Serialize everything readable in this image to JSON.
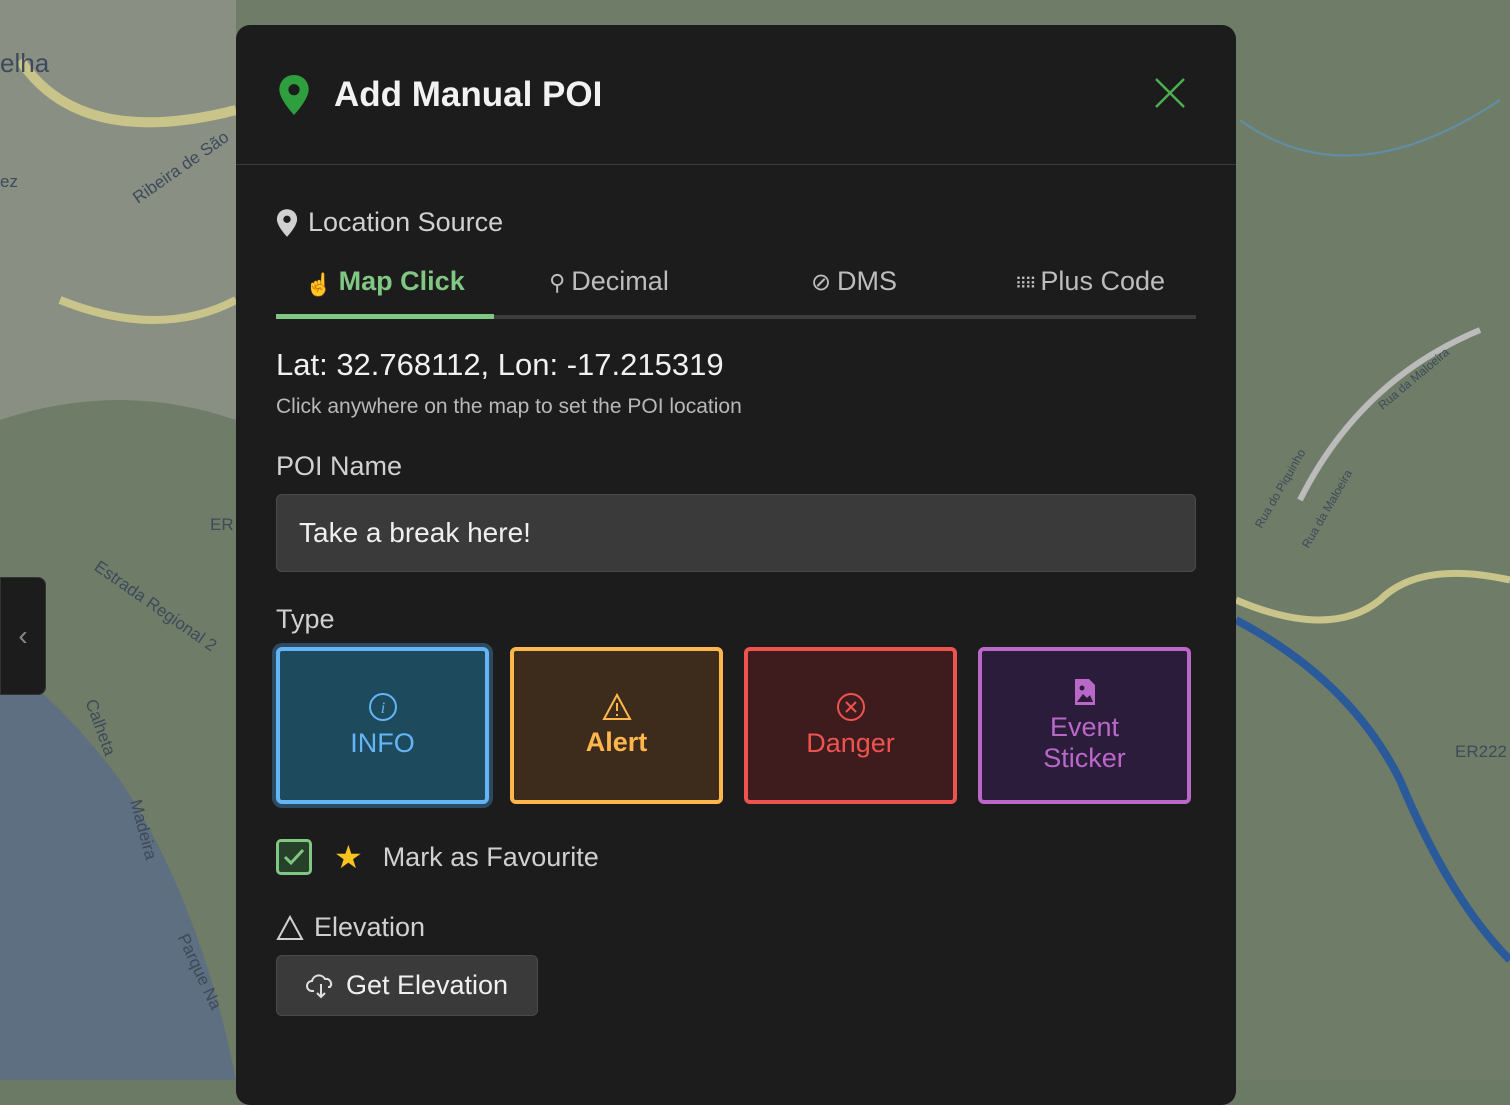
{
  "map": {
    "labels": [
      "elha",
      "ez",
      "Ribeira de São",
      "ER",
      "Estrada Regional 2",
      "Calheta",
      "Madeira",
      "Parque Na",
      "Rua do Piquinho",
      "Rua da Maloeira",
      "Rua da Maloeira",
      "ER222"
    ]
  },
  "dialog": {
    "title": "Add Manual POI",
    "icon": "map-pin-icon",
    "close": "close-icon"
  },
  "location": {
    "section_label": "Location Source",
    "tabs": [
      {
        "label": "Map Click",
        "icon": "hand-pointer-icon",
        "active": true
      },
      {
        "label": "Decimal",
        "icon": "map-marker-outline-icon"
      },
      {
        "label": "DMS",
        "icon": "compass-icon"
      },
      {
        "label": "Plus Code",
        "icon": "grid-icon"
      }
    ],
    "coords": "Lat: 32.768112, Lon: -17.215319",
    "hint": "Click anywhere on the map to set the POI location"
  },
  "poi_name": {
    "label": "POI Name",
    "value": "Take a break here!"
  },
  "type": {
    "label": "Type",
    "selected": "INFO",
    "options": [
      {
        "label": "INFO",
        "color": "#64b5f6",
        "bg": "#1e4a5e",
        "icon": "info-icon"
      },
      {
        "label": "Alert",
        "color": "#ffb74d",
        "bg": "#3d2c1c",
        "icon": "warning-icon"
      },
      {
        "label": "Danger",
        "color": "#ef5350",
        "bg": "#3e1c1e",
        "icon": "x-circle-icon"
      },
      {
        "label": "Event Sticker",
        "color": "#ba68c8",
        "bg": "#2a1c3a",
        "icon": "image-file-icon"
      }
    ]
  },
  "favourite": {
    "label": "Mark as Favourite",
    "checked": true
  },
  "elevation": {
    "label": "Elevation",
    "button": "Get Elevation"
  },
  "colors": {
    "accent": "#81c784",
    "star": "#f9c21d"
  }
}
